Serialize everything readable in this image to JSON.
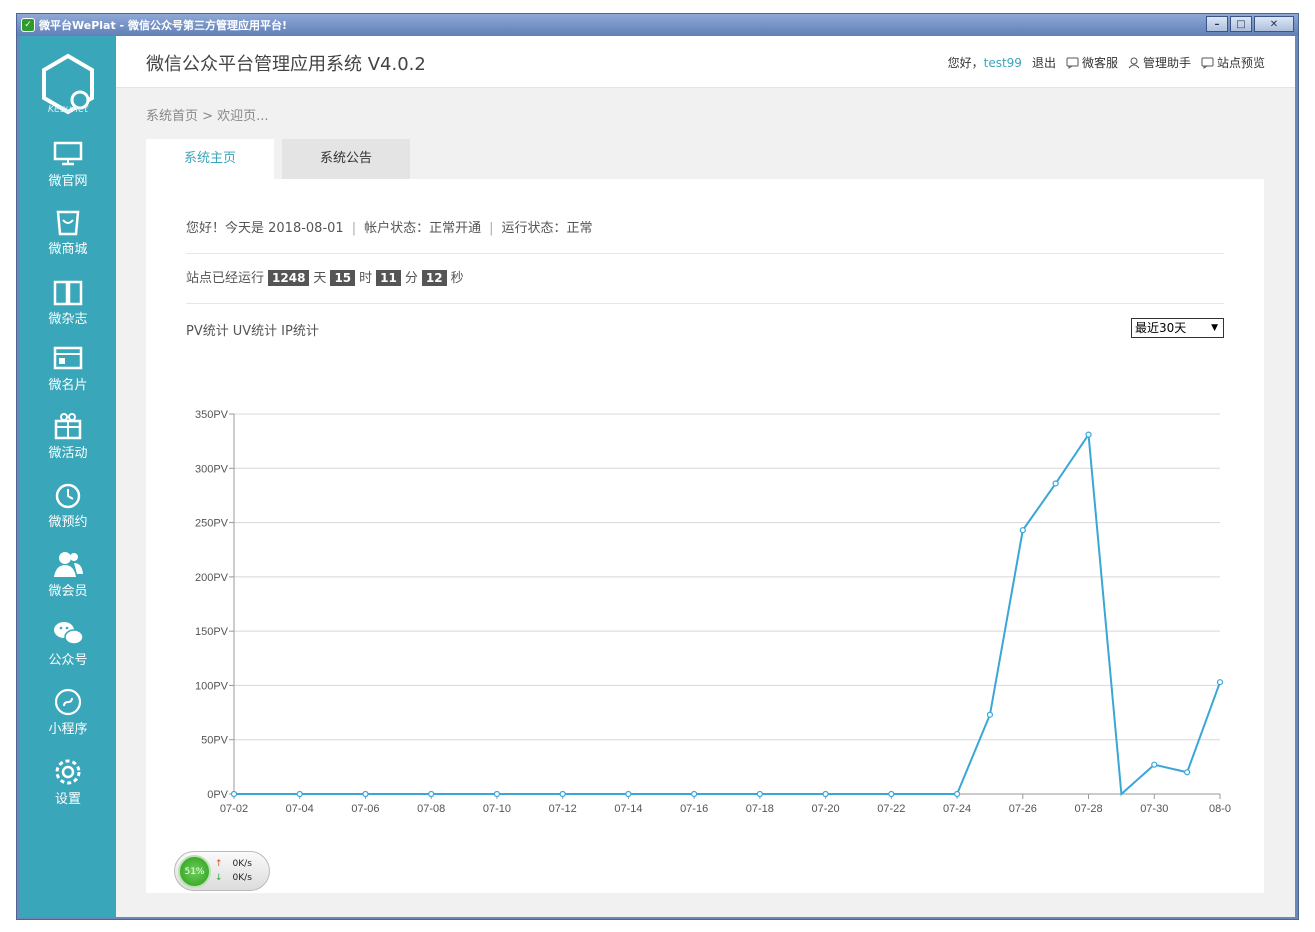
{
  "window": {
    "title": "微平台WePlat - 微信公众号第三方管理应用平台!",
    "controls": {
      "minimize": "–",
      "maximize": "□",
      "close": "✕"
    }
  },
  "sidebar": {
    "logo_text": "Kesunet",
    "items": [
      {
        "label": "微官网",
        "icon": "monitor-icon"
      },
      {
        "label": "微商城",
        "icon": "shopping-bag-icon"
      },
      {
        "label": "微杂志",
        "icon": "book-icon"
      },
      {
        "label": "微名片",
        "icon": "card-icon"
      },
      {
        "label": "微活动",
        "icon": "gift-icon"
      },
      {
        "label": "微预约",
        "icon": "clock-icon"
      },
      {
        "label": "微会员",
        "icon": "users-icon"
      },
      {
        "label": "公众号",
        "icon": "wechat-icon"
      },
      {
        "label": "小程序",
        "icon": "miniprogram-icon"
      },
      {
        "label": "设置",
        "icon": "gear-icon"
      }
    ]
  },
  "header": {
    "title": "微信公众平台管理应用系统 V4.0.2",
    "greeting": "您好，",
    "username": "test99",
    "logout": "退出",
    "links": [
      {
        "label": "微客服",
        "icon": "chat-icon"
      },
      {
        "label": "管理助手",
        "icon": "user-icon"
      },
      {
        "label": "站点预览",
        "icon": "chat-icon"
      }
    ]
  },
  "breadcrumb": "系统首页 > 欢迎页...",
  "tabs": [
    {
      "label": "系统主页",
      "active": true
    },
    {
      "label": "系统公告",
      "active": false
    }
  ],
  "status": {
    "welcome": "您好！今天是 2018-08-01",
    "account": "帐户状态：正常开通",
    "running": "运行状态：正常",
    "sep": "|"
  },
  "uptime": {
    "prefix": "站点已经运行",
    "days": "1248",
    "days_unit": "天",
    "hours": "15",
    "hours_unit": "时",
    "minutes": "11",
    "minutes_unit": "分",
    "seconds": "12",
    "seconds_unit": "秒"
  },
  "stats_tabs": [
    "PV统计",
    "UV统计",
    "IP统计"
  ],
  "range_select": {
    "value": "最近30天",
    "arrow": "▼"
  },
  "netmon": {
    "percent": "51%",
    "up": "0K/s",
    "down": "0K/s",
    "up_arrow": "↑",
    "down_arrow": "↓"
  },
  "colors": {
    "sidebar": "#3aa6b9",
    "accent": "#3aa6b9",
    "line": "#3aa6d8"
  },
  "chart_data": {
    "type": "line",
    "title": "",
    "xlabel": "",
    "ylabel": "",
    "ylim": [
      0,
      350
    ],
    "yticks": [
      0,
      50,
      100,
      150,
      200,
      250,
      300,
      350
    ],
    "ytick_suffix": "PV",
    "x": [
      "07-02",
      "07-03",
      "07-04",
      "07-05",
      "07-06",
      "07-07",
      "07-08",
      "07-09",
      "07-10",
      "07-11",
      "07-12",
      "07-13",
      "07-14",
      "07-15",
      "07-16",
      "07-17",
      "07-18",
      "07-19",
      "07-20",
      "07-21",
      "07-22",
      "07-23",
      "07-24",
      "07-25",
      "07-26",
      "07-27",
      "07-28",
      "07-29",
      "07-30",
      "07-31",
      "08-01"
    ],
    "xtick_labels": [
      "07-02",
      "07-04",
      "07-06",
      "07-08",
      "07-10",
      "07-12",
      "07-14",
      "07-16",
      "07-18",
      "07-20",
      "07-22",
      "07-24",
      "07-26",
      "07-28",
      "07-30",
      "08-0"
    ],
    "series": [
      {
        "values": [
          0,
          0,
          0,
          0,
          0,
          0,
          0,
          0,
          0,
          0,
          0,
          0,
          0,
          0,
          0,
          0,
          0,
          0,
          0,
          0,
          0,
          0,
          0,
          73,
          243,
          286,
          331,
          0,
          27,
          20,
          103
        ]
      }
    ],
    "grid": true,
    "legend": "none"
  }
}
